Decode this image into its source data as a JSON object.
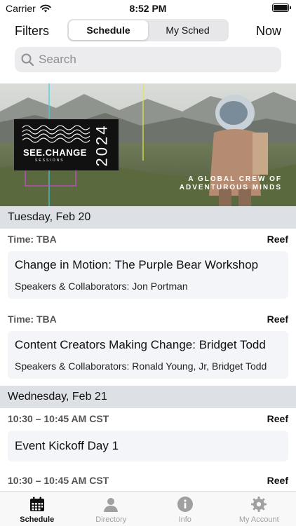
{
  "status_bar": {
    "carrier": "Carrier",
    "time": "8:52 PM"
  },
  "nav": {
    "filters_label": "Filters",
    "now_label": "Now",
    "segments": [
      {
        "label": "Schedule",
        "active": true
      },
      {
        "label": "My Sched",
        "active": false
      }
    ]
  },
  "search": {
    "placeholder": "Search",
    "value": ""
  },
  "banner": {
    "logo_text": "SEE.CHANGE",
    "logo_sub": "SESSIONS",
    "logo_year": "2024",
    "tagline_line1": "A GLOBAL CREW OF",
    "tagline_line2": "ADVENTUROUS MINDS"
  },
  "days": [
    {
      "label": "Tuesday, Feb 20",
      "sessions": [
        {
          "time": "Time: TBA",
          "room": "Reef",
          "title": "Change in Motion: The Purple Bear Workshop",
          "speakers": "Speakers & Collaborators: Jon Portman"
        },
        {
          "time": "Time: TBA",
          "room": "Reef",
          "title": "Content Creators Making Change: Bridget Todd",
          "speakers": "Speakers & Collaborators: Ronald Young, Jr, Bridget Todd"
        }
      ]
    },
    {
      "label": "Wednesday, Feb 21",
      "sessions": [
        {
          "time": "10:30 – 10:45 AM CST",
          "room": "Reef",
          "title": "Event Kickoff Day 1",
          "speakers": ""
        },
        {
          "time": "10:30 – 10:45 AM CST",
          "room": "Reef",
          "title": "",
          "speakers": ""
        }
      ]
    }
  ],
  "tabbar": {
    "items": [
      {
        "label": "Schedule",
        "icon": "calendar-icon",
        "active": true
      },
      {
        "label": "Directory",
        "icon": "person-icon",
        "active": false
      },
      {
        "label": "Info",
        "icon": "info-icon",
        "active": false
      },
      {
        "label": "My Account",
        "icon": "gear-icon",
        "active": false
      }
    ]
  },
  "colors": {
    "day_header_bg": "#dde1e6",
    "card_bg": "#f4f5f8",
    "inactive_tab": "#a0a0a0"
  }
}
